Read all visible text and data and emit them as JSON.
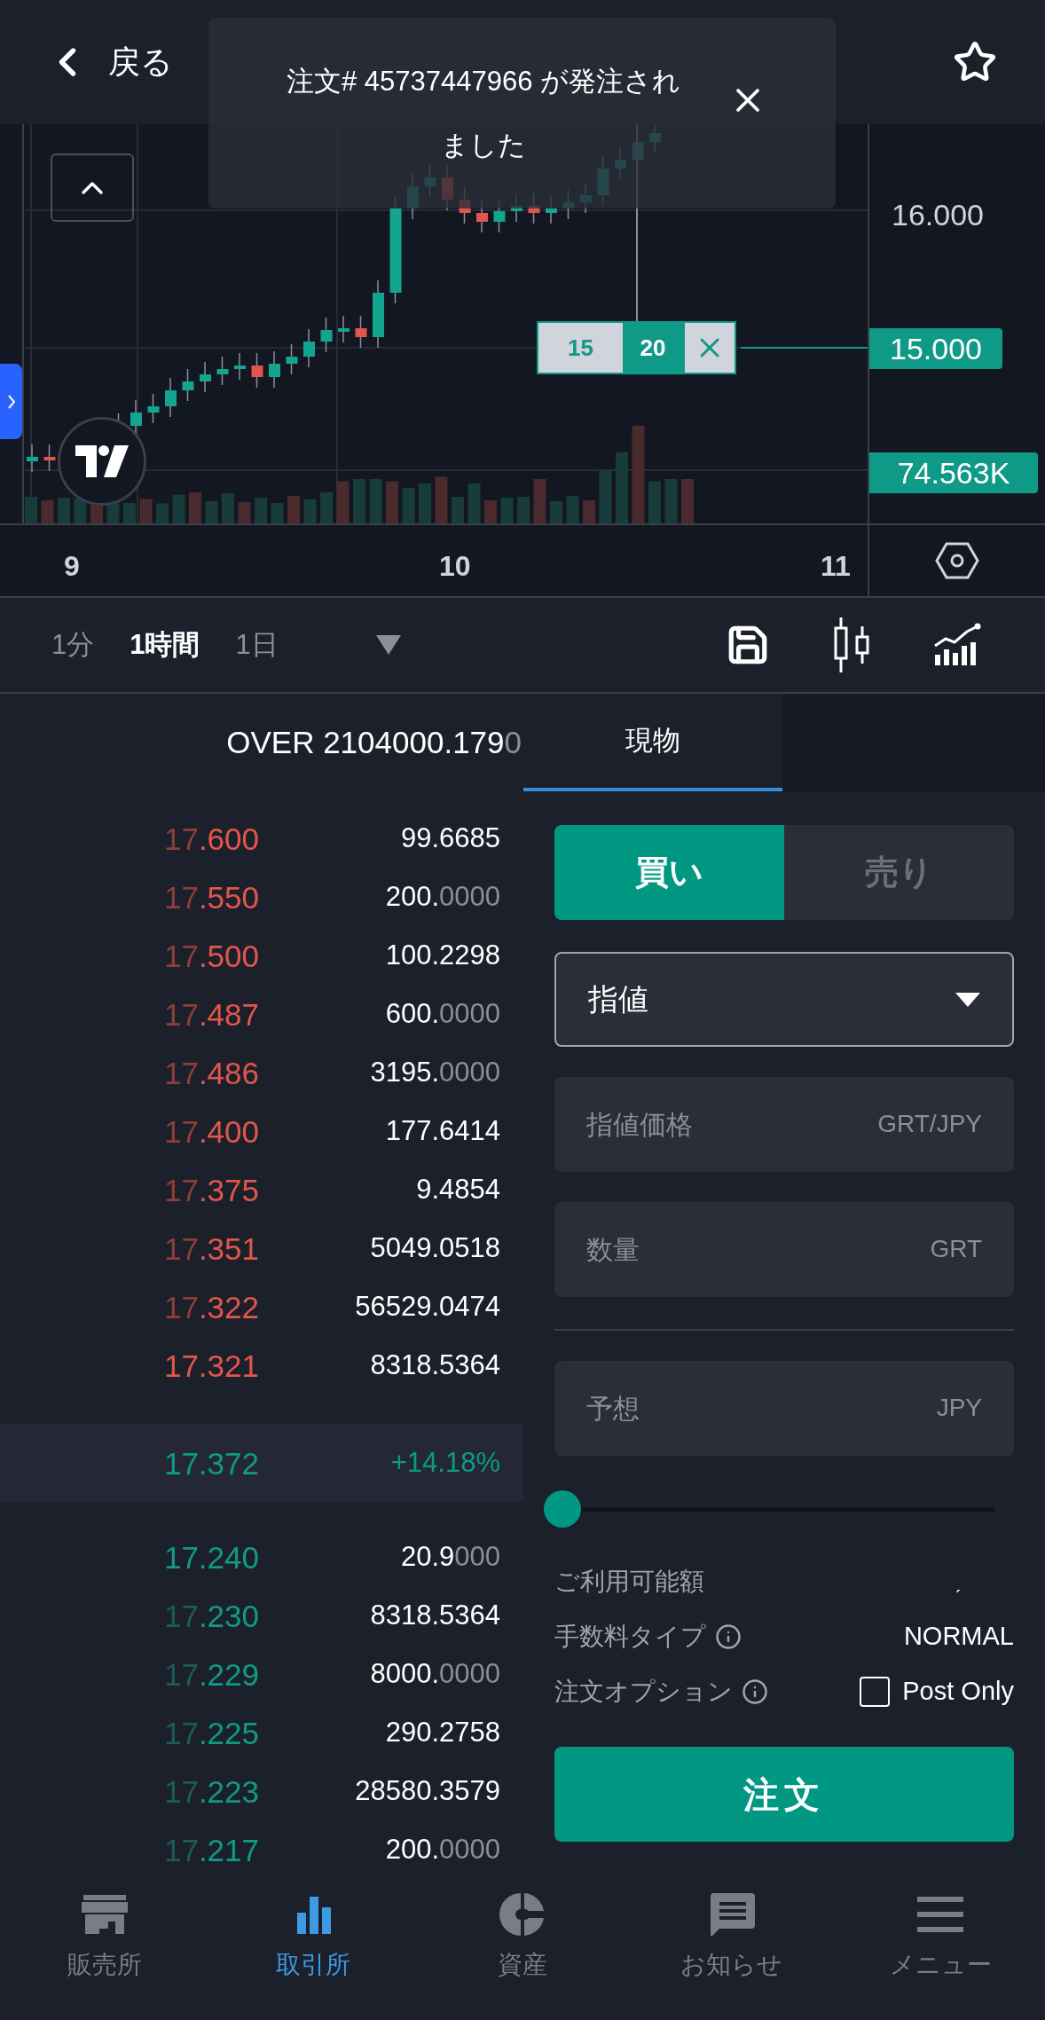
{
  "header": {
    "back_label": "戻る",
    "favorite": false
  },
  "toast": {
    "message_lines": [
      "注文# 45737447966 が発注され",
      "ました"
    ]
  },
  "chart": {
    "price_label": "16.000",
    "order_price_tag": "15.000",
    "volume_tag": "74.563K",
    "time_labels": [
      "9",
      "10",
      "11"
    ],
    "order_ticket": {
      "label": "15",
      "quantity": "20"
    }
  },
  "toolbar": {
    "intervals": [
      {
        "label": "1分",
        "selected": false
      },
      {
        "label": "1時間",
        "selected": true
      },
      {
        "label": "1日",
        "selected": false
      }
    ]
  },
  "order_book": {
    "header": "OVER 2104000.1790",
    "asks": [
      {
        "price": "17.600",
        "amount": "99.6685"
      },
      {
        "price": "17.550",
        "amount": "200.0000"
      },
      {
        "price": "17.500",
        "amount": "100.2298"
      },
      {
        "price": "17.487",
        "amount": "600.0000"
      },
      {
        "price": "17.486",
        "amount": "3195.0000"
      },
      {
        "price": "17.400",
        "amount": "177.6414"
      },
      {
        "price": "17.375",
        "amount": "9.4854"
      },
      {
        "price": "17.351",
        "amount": "5049.0518"
      },
      {
        "price": "17.322",
        "amount": "56529.0474"
      },
      {
        "price": "17.321",
        "amount": "8318.5364"
      }
    ],
    "last": {
      "price": "17.372",
      "change": "+14.18%"
    },
    "bids": [
      {
        "price": "17.240",
        "amount": "20.9000"
      },
      {
        "price": "17.230",
        "amount": "8318.5364"
      },
      {
        "price": "17.229",
        "amount": "8000.0000"
      },
      {
        "price": "17.225",
        "amount": "290.2758"
      },
      {
        "price": "17.223",
        "amount": "28580.3579"
      },
      {
        "price": "17.217",
        "amount": "200.0000"
      }
    ]
  },
  "tabs": [
    {
      "label": "現物",
      "selected": true
    }
  ],
  "order_form": {
    "sides": [
      {
        "label": "買い",
        "selected": true
      },
      {
        "label": "売り",
        "selected": false
      }
    ],
    "order_type": "指値",
    "fields": [
      {
        "placeholder": "指値価格",
        "unit": "GRT/JPY"
      },
      {
        "placeholder": "数量",
        "unit": "GRT"
      },
      {
        "placeholder": "予想",
        "unit": "JPY"
      }
    ],
    "amount_slider": {
      "level": 0
    },
    "available": {
      "label": "ご利用可能額",
      "value": "ˏ"
    },
    "fee_type": {
      "label": "手数料タイプ",
      "value": "NORMAL"
    },
    "option": {
      "label": "注文オプション",
      "post_only_label": "Post Only",
      "checked": false
    },
    "submit": "注文"
  },
  "bottom_nav": [
    {
      "label": "販売所",
      "kind": "store",
      "selected": false
    },
    {
      "label": "取引所",
      "kind": "bars",
      "selected": true
    },
    {
      "label": "資産",
      "kind": "pie",
      "selected": false
    },
    {
      "label": "お知らせ",
      "kind": "message",
      "selected": false
    },
    {
      "label": "メニュー",
      "kind": "menu",
      "selected": false
    }
  ]
}
